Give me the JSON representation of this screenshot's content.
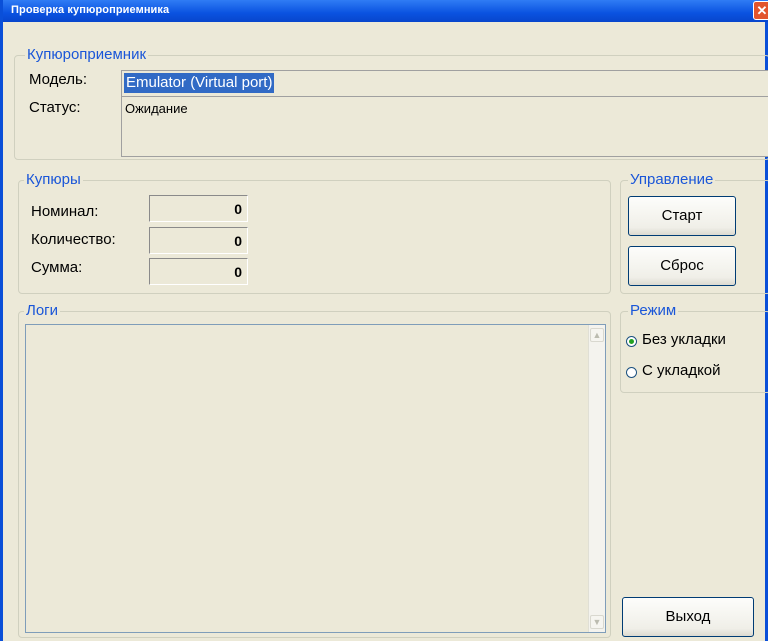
{
  "window": {
    "title": "Проверка купюроприемника",
    "close_glyph": "✕"
  },
  "acceptor": {
    "legend": "Купюроприемник",
    "model_label": "Модель:",
    "model_value": "Emulator (Virtual port)",
    "status_label": "Статус:",
    "status_value": "Ожидание"
  },
  "bills": {
    "legend": "Купюры",
    "nominal_label": "Номинал:",
    "nominal_value": "0",
    "quantity_label": "Количество:",
    "quantity_value": "0",
    "sum_label": "Сумма:",
    "sum_value": "0"
  },
  "control": {
    "legend": "Управление",
    "start_label": "Старт",
    "reset_label": "Сброс"
  },
  "logs": {
    "legend": "Логи",
    "content": ""
  },
  "mode": {
    "legend": "Режим",
    "options": [
      {
        "label": "Без укладки",
        "selected": true
      },
      {
        "label": "С укладкой",
        "selected": false
      }
    ]
  },
  "exit_label": "Выход",
  "colors": {
    "title_bar": "#0a52e0",
    "legend": "#1a56d8",
    "selection": "#316ac5",
    "window_bg": "#ece9d8"
  }
}
